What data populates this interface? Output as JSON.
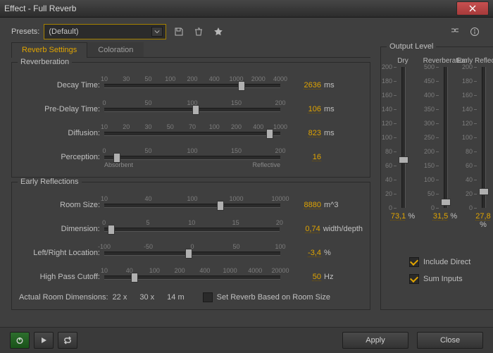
{
  "window_title": "Effect - Full Reverb",
  "presets_label": "Presets:",
  "preset_value": "(Default)",
  "tabs": {
    "settings": "Reverb Settings",
    "coloration": "Coloration"
  },
  "reverberation": {
    "title": "Reverberation",
    "decay": {
      "label": "Decay Time:",
      "ticks": [
        "10",
        "30",
        "50",
        "100",
        "200",
        "400",
        "1000",
        "2000",
        "4000"
      ],
      "value": "2636",
      "unit": "ms",
      "pos": 78
    },
    "predelay": {
      "label": "Pre-Delay Time:",
      "ticks": [
        "0",
        "50",
        "100",
        "150",
        "200"
      ],
      "value": "106",
      "unit": "ms",
      "pos": 52
    },
    "diffusion": {
      "label": "Diffusion:",
      "ticks": [
        "10",
        "20",
        "30",
        "50",
        "70",
        "100",
        "200",
        "400",
        "1000"
      ],
      "value": "823",
      "unit": "ms",
      "pos": 94
    },
    "perception": {
      "label": "Perception:",
      "ticks": [
        "0",
        "50",
        "100",
        "150",
        "200"
      ],
      "value": "16",
      "unit": "",
      "pos": 7,
      "left_ext": "Absorbent",
      "right_ext": "Reflective"
    }
  },
  "early": {
    "title": "Early Reflections",
    "room_size": {
      "label": "Room Size:",
      "ticks": [
        "10",
        "40",
        "100",
        "1000",
        "10000"
      ],
      "value": "8880",
      "unit": "m^3",
      "pos": 66
    },
    "dimension": {
      "label": "Dimension:",
      "ticks": [
        "0",
        "5",
        "10",
        "15",
        "20"
      ],
      "value": "0,74",
      "unit": "width/depth",
      "pos": 4
    },
    "lr_loc": {
      "label": "Left/Right Location:",
      "ticks": [
        "-100",
        "-50",
        "0",
        "50",
        "100"
      ],
      "value": "-3,4",
      "unit": "%",
      "pos": 48
    },
    "hpf": {
      "label": "High Pass Cutoff:",
      "ticks": [
        "10",
        "40",
        "100",
        "200",
        "400",
        "1000",
        "4000",
        "20000"
      ],
      "value": "50",
      "unit": "Hz",
      "pos": 17
    },
    "dims_label": "Actual Room Dimensions:",
    "dims_x": "22 x",
    "dims_y": "30 x",
    "dims_z": "14 m",
    "set_reverb_label": "Set Reverb Based on Room Size"
  },
  "output": {
    "title": "Output Level",
    "dry": {
      "title": "Dry",
      "ticks": [
        200,
        180,
        160,
        140,
        120,
        100,
        80,
        60,
        40,
        20,
        0
      ],
      "max": 200,
      "value": "73,1",
      "pos": 63.5
    },
    "rev": {
      "title": "Reverberation",
      "ticks": [
        500,
        450,
        400,
        350,
        300,
        250,
        200,
        150,
        100,
        50,
        0
      ],
      "max": 500,
      "value": "31,5",
      "pos": 93.7
    },
    "er": {
      "title": "Early Reflections",
      "ticks": [
        200,
        180,
        160,
        140,
        120,
        100,
        80,
        60,
        40,
        20,
        0
      ],
      "max": 200,
      "value": "27,8",
      "pos": 86.1
    },
    "include_direct": "Include Direct",
    "sum_inputs": "Sum  Inputs"
  },
  "buttons": {
    "apply": "Apply",
    "close": "Close"
  }
}
